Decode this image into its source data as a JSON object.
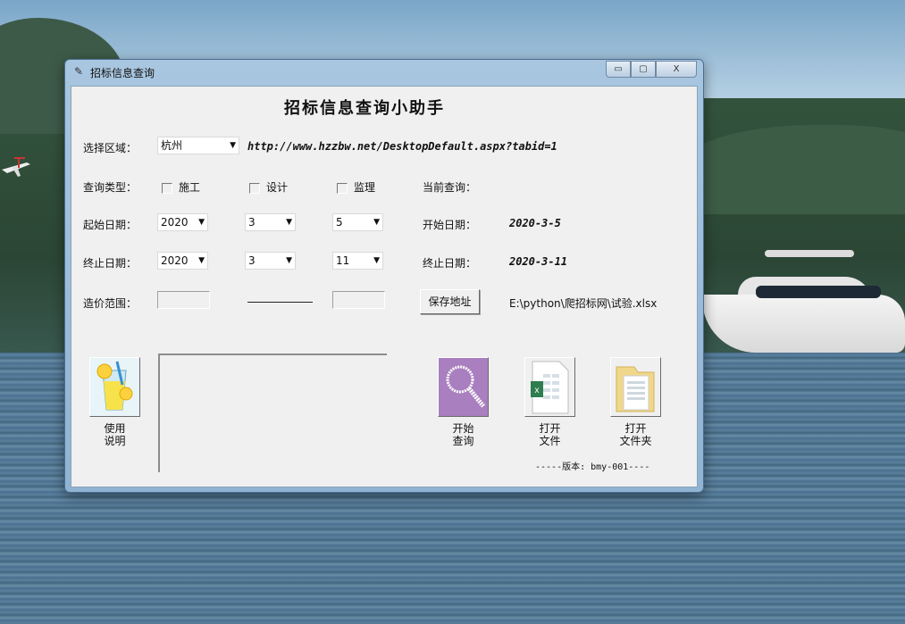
{
  "window": {
    "title": "招标信息查询",
    "icon": "feather-icon",
    "controls": {
      "minimize": "▭",
      "maximize": "▢",
      "close": "X"
    }
  },
  "app": {
    "heading": "招标信息查询小助手",
    "region": {
      "label": "选择区域：",
      "value": "杭州",
      "url": "http://www.hzzbw.net/DesktopDefault.aspx?tabid=1"
    },
    "type": {
      "label": "查询类型：",
      "options": [
        {
          "label": "施工",
          "checked": false
        },
        {
          "label": "设计",
          "checked": false
        },
        {
          "label": "监理",
          "checked": false
        }
      ],
      "current_label": "当前查询："
    },
    "start": {
      "label": "起始日期：",
      "year": "2020",
      "month": "3",
      "day": "5",
      "display_label": "开始日期：",
      "display_value": "2020-3-5"
    },
    "end": {
      "label": "终止日期：",
      "year": "2020",
      "month": "3",
      "day": "11",
      "display_label": "终止日期：",
      "display_value": "2020-3-11"
    },
    "price": {
      "label": "造价范围：",
      "min": "",
      "max": ""
    },
    "save": {
      "button": "保存地址",
      "path": "E:\\python\\爬招标网\\试验.xlsx"
    },
    "buttons": {
      "help": "使用\n说明",
      "search": "开始\n查询",
      "open_file": "打开\n文件",
      "open_folder": "打开\n文件夹"
    },
    "version": "-----版本: bmy-001----"
  },
  "icons": [
    "lemonade-icon",
    "magnifier-icon",
    "excel-file-icon",
    "folder-icon"
  ],
  "colors": {
    "search_tile": "#a97fbf",
    "excel_green": "#2e7d4f",
    "folder_yellow": "#f0d88a"
  }
}
